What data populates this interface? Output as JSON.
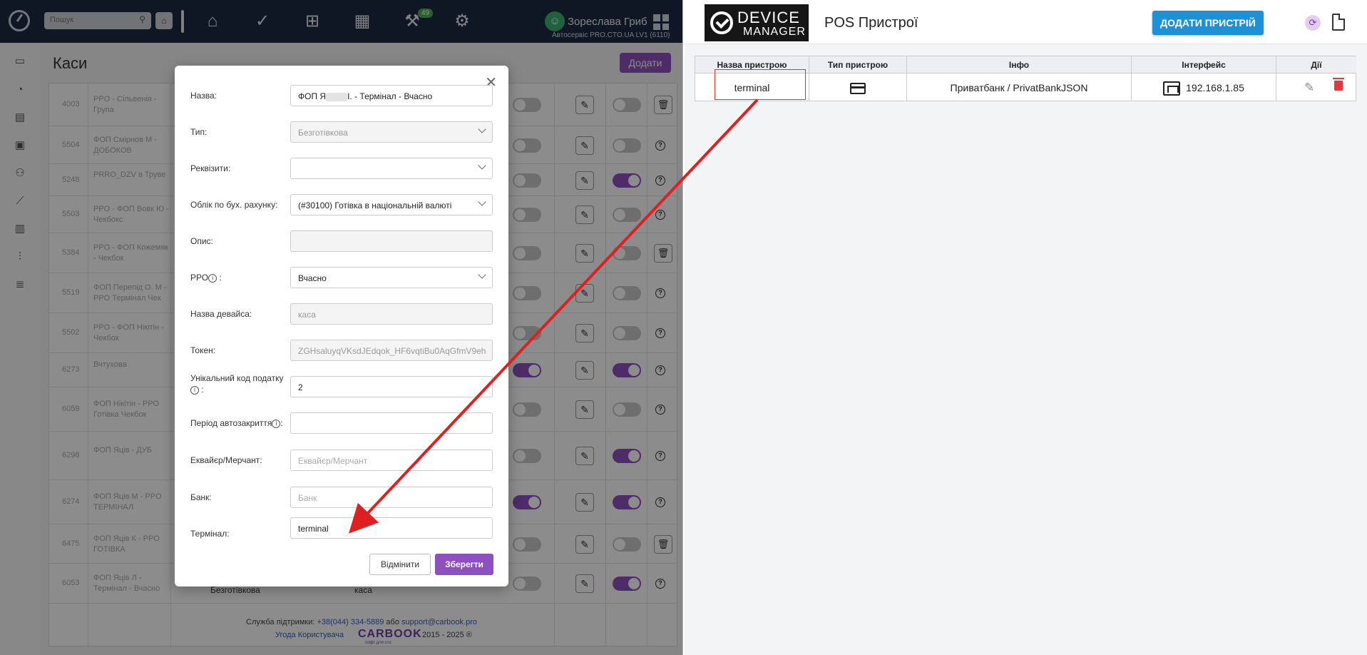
{
  "left_app": {
    "search_placeholder": "Пошук",
    "badge": "49",
    "user_name": "Зорeслава Гриб",
    "user_sub": "Автосервіс PRO.CTO.UA LV1 (6110)",
    "page_title": "Каси",
    "add_button": "Додати",
    "rows": [
      {
        "id": "4003",
        "name": "PPO - Сільвенія - Група",
        "extra": ""
      },
      {
        "id": "5504",
        "name": "ФОП Смірнов М - ДОБОКОВ",
        "extra": ""
      },
      {
        "id": "5248",
        "name": "PRRO_DZV в Труве",
        "extra": ""
      },
      {
        "id": "5503",
        "name": "PPO - ФОП Вовк Ю - Чекбокс",
        "extra": ""
      },
      {
        "id": "5384",
        "name": "PPO - ФОП Кожемяк - Чекбок",
        "extra": ""
      },
      {
        "id": "5519",
        "name": "ФОП Перепід О. М - PPO Термінал Чек",
        "extra": ""
      },
      {
        "id": "5502",
        "name": "PPO - ФОП Нікітін - Чекбок",
        "extra": ""
      },
      {
        "id": "6273",
        "name": "Вчтухова",
        "extra": ""
      },
      {
        "id": "6059",
        "name": "ФОП Нікітін - PPO Готівка Чекбок",
        "extra": ""
      },
      {
        "id": "6298",
        "name": "ФОП Яців - ДУБ",
        "extra": ""
      },
      {
        "id": "6274",
        "name": "ФОП Яців М - PPO ТЕРМІНАЛ",
        "extra": ""
      },
      {
        "id": "6475",
        "name": "ФОП Яців К - PPO ГОТІВКА",
        "extra": ""
      },
      {
        "id": "6053",
        "name": "ФОП Яців Л - Термінал - Вчасно",
        "extra": "Безготівкова"
      }
    ],
    "last_row_col": "каса",
    "footer": {
      "support_label": "Служба підтримки:",
      "phone": "+38(044) 334-5889",
      "or": "або",
      "email": "support@carbook.pro",
      "agreement": "Угода Користувача",
      "logo": "CARBOOK",
      "logo_sub": "софт для сто",
      "years": "2015 - 2025"
    }
  },
  "modal": {
    "fields": [
      {
        "label": "Назва:",
        "value": "ФОП Я",
        "value_tail": "І. - Термінал - Вчасно",
        "kind": "text"
      },
      {
        "label": "Тип:",
        "value": "Безготівкова",
        "kind": "select-disabled"
      },
      {
        "label": "Реквізити:",
        "value": "",
        "kind": "select"
      },
      {
        "label": "Облік по бух. рахунку:",
        "value": "(#30100) Готівка в національній валюті",
        "kind": "select"
      },
      {
        "label": "Опис:",
        "value": "",
        "kind": "disabled"
      },
      {
        "label": "РРО",
        "value": "Вчасно",
        "kind": "select"
      },
      {
        "label": "Назва девайса:",
        "value": "каса",
        "kind": "disabled"
      },
      {
        "label": "Токен:",
        "value": "ZGHsaluyqVKsdJEdqok_HF6vqtiBu0AqGfmV9eh",
        "kind": "disabled"
      },
      {
        "label": "Унікальний код податку",
        "value": "2",
        "kind": "text"
      },
      {
        "label": "Період автозакриття",
        "value": "",
        "kind": "text"
      },
      {
        "label": "Еквайєр/Мерчант:",
        "value": "Еквайєр/Мерчант",
        "kind": "placeholder"
      },
      {
        "label": "Банк:",
        "value": "Банк",
        "kind": "placeholder"
      },
      {
        "label": "Термінал:",
        "value": "terminal",
        "kind": "text"
      }
    ],
    "info_glyph": "i",
    "colon": ":",
    "cancel": "Відмінити",
    "save": "Зберегти"
  },
  "right_app": {
    "logo_top": "DEVICE",
    "logo_bottom": "MANAGER",
    "title": "POS Пристрої",
    "add_button": "ДОДАТИ ПРИСТРІЙ",
    "headers": [
      "Назва пристрою",
      "Тип пристрою",
      "Інфо",
      "Інтерфейс",
      "Дії"
    ],
    "row": {
      "name": "terminal",
      "type_icon": "card-icon",
      "info": "Приватбанк / PrivatBankJSON",
      "interface_ip": "192.168.1.85",
      "interface_icon": "ethernet-icon"
    }
  },
  "annotation": {
    "color": "#e02020"
  }
}
